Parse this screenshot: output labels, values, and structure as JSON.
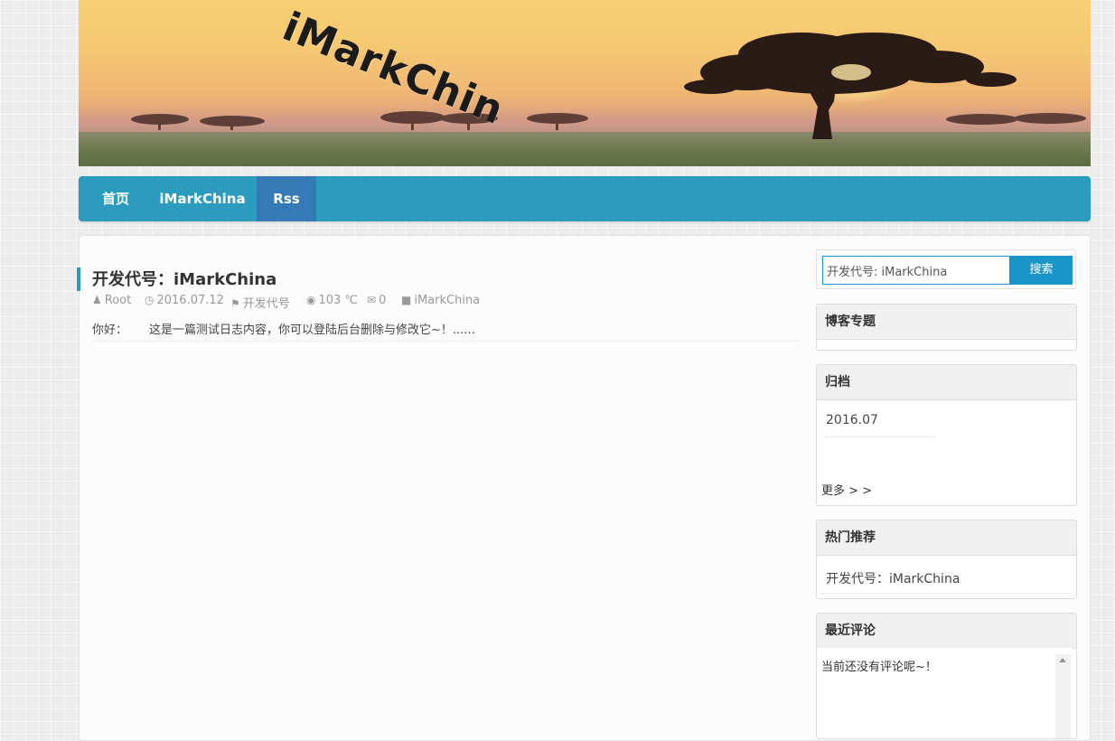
{
  "banner": {
    "logo_text": "iMarkChin"
  },
  "nav": {
    "items": [
      {
        "label": "首页"
      },
      {
        "label": "iMarkChina"
      },
      {
        "label": "Rss"
      }
    ]
  },
  "post": {
    "title": "开发代号：iMarkChina",
    "meta": {
      "author": "Root",
      "date": "2016.07.12",
      "tag": "开发代号",
      "views": "103 ℃",
      "comments": "0",
      "category": "iMarkChina"
    },
    "excerpt_greeting": "你好：",
    "excerpt_body": "这是一篇测试日志内容，你可以登陆后台删除与修改它~！......"
  },
  "sidebar": {
    "search": {
      "value": "开发代号: iMarkChina",
      "button_label": "搜索"
    },
    "topics": {
      "title": "博客专题"
    },
    "archive": {
      "title": "归档",
      "items": [
        "2016.07"
      ],
      "more_label": "更多 > >"
    },
    "hot": {
      "title": "热门推荐",
      "items": [
        "开发代号：iMarkChina"
      ]
    },
    "recent_comments": {
      "title": "最近评论",
      "empty_text": "当前还没有评论呢~！"
    }
  },
  "icons": {
    "author": "user-icon",
    "date": "clock-icon",
    "tag": "tag-icon",
    "views": "eye-icon",
    "comments": "comment-icon",
    "category": "folder-icon"
  },
  "colors": {
    "nav_bg": "#2b9cbd",
    "nav_active": "#337ab7",
    "search_button": "#1b95c7",
    "accent_bar": "#2b9cbd"
  }
}
